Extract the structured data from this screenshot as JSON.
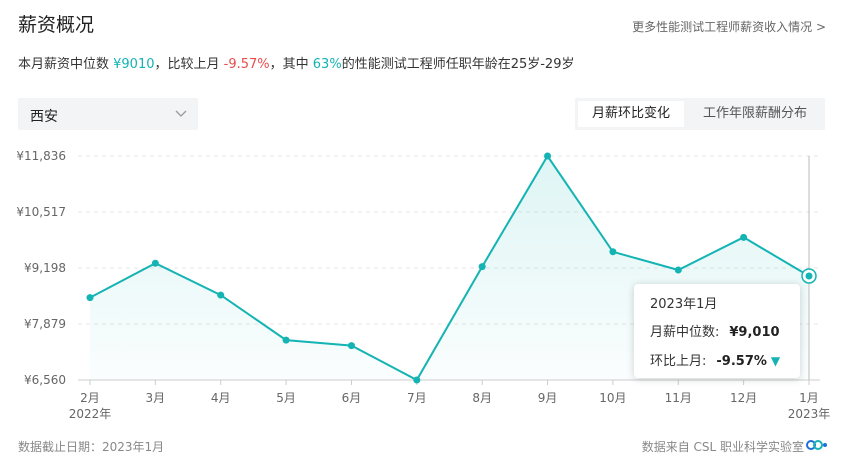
{
  "header": {
    "title": "薪资概况",
    "more_link": "更多性能测试工程师薪资收入情况 >"
  },
  "summary": {
    "p1": "本月薪资中位数 ",
    "median": "¥9010",
    "p2": "，比较上月 ",
    "change": "-9.57%",
    "p3": "，其中 ",
    "percent": "63%",
    "p4": "的性能测试工程师任职年龄在25岁-29岁"
  },
  "city_select": {
    "value": "西安",
    "icon": "chevron-down-icon"
  },
  "tabs": [
    {
      "label": "月薪环比变化",
      "active": true
    },
    {
      "label": "工作年限薪酬分布",
      "active": false
    }
  ],
  "tooltip": {
    "title": "2023年1月",
    "label1": "月薪中位数:",
    "value1": "¥9,010",
    "label2": "环比上月:",
    "value2": "-9.57%",
    "arrow": "▼"
  },
  "footer": {
    "left": "数据截止日期：2023年1月",
    "right": "数据来自 CSL 职业科学实验室",
    "logo_icon": "csl-logo-icon"
  },
  "colors": {
    "accent": "#14b3b4",
    "negative": "#e84c4c"
  },
  "chart_data": {
    "type": "area",
    "categories": [
      "2月",
      "3月",
      "4月",
      "5月",
      "6月",
      "7月",
      "8月",
      "9月",
      "10月",
      "11月",
      "12月",
      "1月"
    ],
    "year_labels": [
      "2022年",
      "",
      "",
      "",
      "",
      "",
      "",
      "",
      "",
      "",
      "",
      "2023年"
    ],
    "values": [
      8500,
      9310,
      8560,
      7500,
      7370,
      6560,
      9230,
      11836,
      9580,
      9150,
      9920,
      9010
    ],
    "y_ticks": [
      "¥6,560",
      "¥7,879",
      "¥9,198",
      "¥10,517",
      "¥11,836"
    ],
    "ylim": [
      6560,
      11836
    ],
    "grid": true,
    "highlight_index": 11
  }
}
